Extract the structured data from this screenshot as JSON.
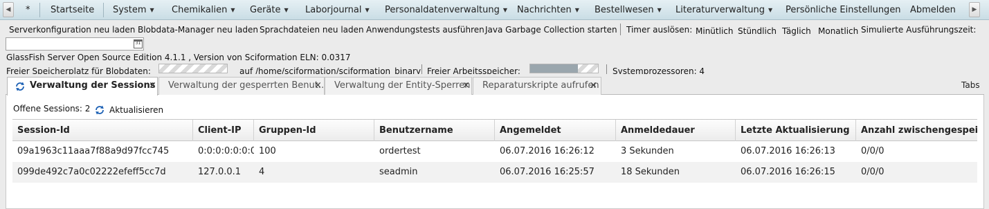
{
  "menu": {
    "items": [
      {
        "label": "*",
        "caret": false
      },
      {
        "label": "Startseite",
        "caret": false
      },
      {
        "label": "System",
        "caret": true
      },
      {
        "label": "Chemikalien",
        "caret": true
      },
      {
        "label": "Geräte",
        "caret": true
      },
      {
        "label": "Laborjournal",
        "caret": true
      },
      {
        "label": "Personaldatenverwaltung",
        "caret": true
      },
      {
        "label": "Nachrichten",
        "caret": true
      },
      {
        "label": "Bestellwesen",
        "caret": true
      },
      {
        "label": "Literaturverwaltung",
        "caret": true
      },
      {
        "label": "Persönliche Einstellungen",
        "caret": false
      },
      {
        "label": "Abmelden",
        "caret": false
      }
    ]
  },
  "toolbar": {
    "server_config": "Serverkonfiguration neu laden",
    "blobdata_manager": "Blobdata-Manager neu laden",
    "language_files": "Sprachdateien neu laden",
    "app_tests": "Anwendungstests ausführen",
    "java_gc": "Java Garbage Collection starten",
    "timer_label": "Timer auslösen:",
    "minutely": "Minütlich",
    "hourly": "Stündlich",
    "daily": "Täglich",
    "monthly": "Monatlich",
    "simulated_time_label": "Simulierte Ausführungszeit:"
  },
  "date_input": {
    "value": "",
    "calendar_day": "31"
  },
  "server_info": "GlassFish Server Open Source Edition 4.1.1 , Version von Sciformation ELN: 0.0317",
  "resources": {
    "blob_label": "Freier Speicherplatz für Blobdaten:",
    "blob_path": "auf /home/sciformation/sciformation_binary",
    "memory_label": "Freier Arbeitsspeicher:",
    "processors_label": "Systemprozessoren: 4"
  },
  "tabs": [
    {
      "label": "Verwaltung der Sessions",
      "active": true,
      "icon": "refresh-icon"
    },
    {
      "label": "Verwaltung der gesperrten Benut...",
      "active": false
    },
    {
      "label": "Verwaltung der Entity-Sperren",
      "active": false
    },
    {
      "label": "Reparaturskripte aufrufen",
      "active": false
    }
  ],
  "tabs_menu_label": "Tabs",
  "sessions": {
    "count_label": "Offene Sessions: 2",
    "refresh_label": "Aktualisieren",
    "columns": [
      "Session-Id",
      "Client-IP",
      "Gruppen-Id",
      "Benutzername",
      "Angemeldet",
      "Anmeldedauer",
      "Letzte Aktualisierung",
      "Anzahl zwischengespeichert"
    ],
    "rows": [
      [
        "09a1963c11aaa7f88a9d97fcc745",
        "0:0:0:0:0:0:0:1",
        "100",
        "ordertest",
        "06.07.2016 16:26:12",
        "3 Sekunden",
        "06.07.2016 16:26:13",
        "0/0/0"
      ],
      [
        "099de492c7a0c02222efeff5cc7d",
        "127.0.0.1",
        "4",
        "seadmin",
        "06.07.2016 16:25:57",
        "18 Sekunden",
        "06.07.2016 16:26:15",
        "0/0/0"
      ]
    ]
  },
  "colors": {
    "menubar_top": "#e6f0f4",
    "menubar_bottom": "#c9dde5",
    "refresh_icon": "#1a5fb4"
  }
}
